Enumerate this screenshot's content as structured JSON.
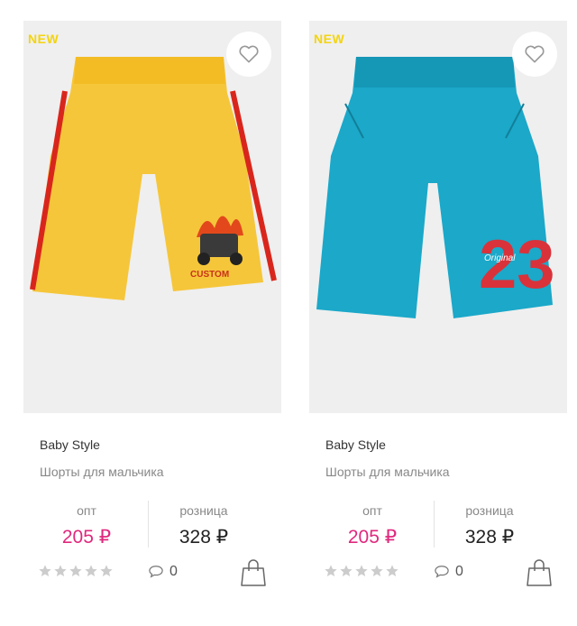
{
  "products": [
    {
      "badge": "NEW",
      "brand": "Baby Style",
      "name": "Шорты для мальчика",
      "opt_label": "опт",
      "opt_price": "205 ₽",
      "retail_label": "розница",
      "retail_price": "328 ₽",
      "comments_count": "0",
      "rating": 0,
      "shorts_color": "#f6c63a",
      "stripe_color": "#d9261c",
      "print_text": "CUSTOM"
    },
    {
      "badge": "NEW",
      "brand": "Baby Style",
      "name": "Шорты для мальчика",
      "opt_label": "опт",
      "opt_price": "205 ₽",
      "retail_label": "розница",
      "retail_price": "328 ₽",
      "comments_count": "0",
      "rating": 0,
      "shorts_color": "#1ba8c9",
      "stripe_color": "#1ba8c9",
      "print_text": "23"
    }
  ],
  "colors": {
    "accent_new": "#f4d40f",
    "opt_price": "#e0287d",
    "star_empty": "#cccccc"
  },
  "icons": {
    "favorite": "heart-icon",
    "comments": "comment-bubble-icon",
    "cart": "shopping-bag-icon",
    "rating": "star-icon"
  }
}
